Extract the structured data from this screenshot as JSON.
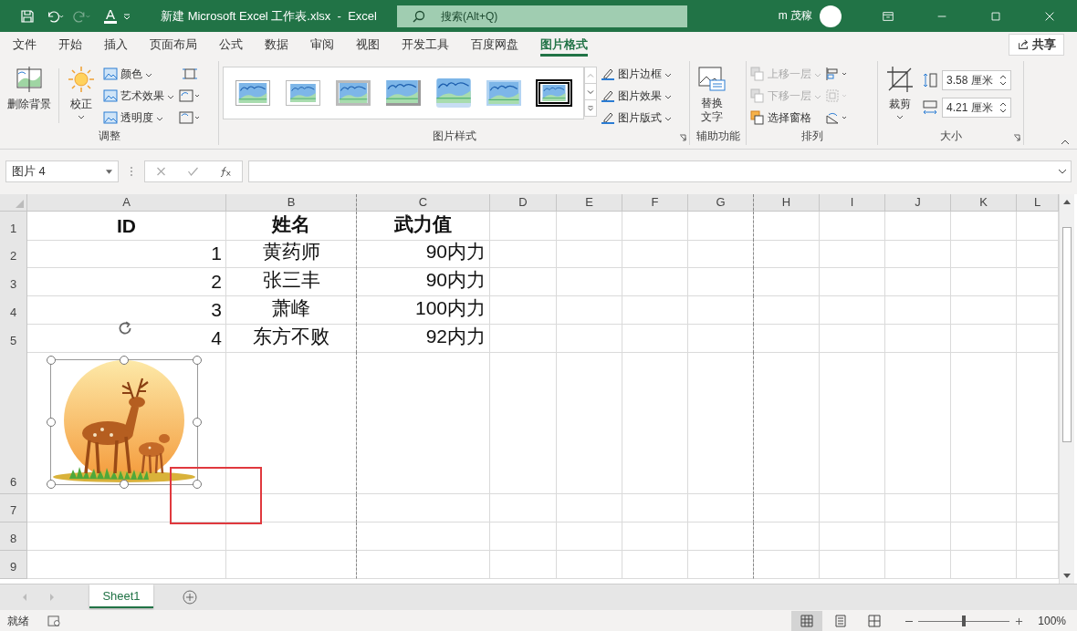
{
  "title_bar": {
    "title": "新建 Microsoft Excel 工作表.xlsx  -  Excel",
    "font_color_glyph": "A",
    "redo_disabled": true,
    "search": {
      "placeholder": "搜索(Alt+Q)"
    },
    "user": "m 茂稼"
  },
  "ribbon_tabs": [
    {
      "label": "文件",
      "selected": false
    },
    {
      "label": "开始",
      "selected": false
    },
    {
      "label": "插入",
      "selected": false
    },
    {
      "label": "页面布局",
      "selected": false
    },
    {
      "label": "公式",
      "selected": false
    },
    {
      "label": "数据",
      "selected": false
    },
    {
      "label": "审阅",
      "selected": false
    },
    {
      "label": "视图",
      "selected": false
    },
    {
      "label": "开发工具",
      "selected": false
    },
    {
      "label": "百度网盘",
      "selected": false
    },
    {
      "label": "图片格式",
      "selected": true
    }
  ],
  "share": "共享",
  "ribbon": {
    "adjust": {
      "label": "调整",
      "remove_background": "删除背景",
      "corrections": "校正",
      "items": [
        {
          "label": "颜色"
        },
        {
          "label": "艺术效果"
        },
        {
          "label": "透明度"
        }
      ]
    },
    "styles": {
      "label": "图片样式",
      "gallery": [
        {
          "kind": "simple"
        },
        {
          "kind": "bevel"
        },
        {
          "kind": "thick"
        },
        {
          "kind": "shadow"
        },
        {
          "kind": "reflect"
        },
        {
          "kind": "soft"
        },
        {
          "kind": "double"
        }
      ],
      "items": [
        {
          "label": "图片边框"
        },
        {
          "label": "图片效果"
        },
        {
          "label": "图片版式"
        }
      ]
    },
    "accessibility": {
      "label": "辅助功能",
      "alt_text": "替换文字"
    },
    "arrange": {
      "label": "排列",
      "items": [
        {
          "label": "上移一层",
          "disabled": true
        },
        {
          "label": "下移一层",
          "disabled": true
        },
        {
          "label": "选择窗格",
          "disabled": false
        }
      ],
      "tools": [
        {
          "kind": "align",
          "disabled": false
        },
        {
          "kind": "group",
          "disabled": true
        },
        {
          "kind": "rotate",
          "disabled": false
        }
      ]
    },
    "size": {
      "label": "大小",
      "crop": "裁剪",
      "height": "3.58 厘米",
      "width": "4.21 厘米"
    }
  },
  "formula_bar": {
    "name_box": "图片 4"
  },
  "columns": [
    {
      "label": "A",
      "page_break_before": false
    },
    {
      "label": "B",
      "page_break_before": false
    },
    {
      "label": "C",
      "page_break_before": true
    },
    {
      "label": "D",
      "page_break_before": false
    },
    {
      "label": "E",
      "page_break_before": false
    },
    {
      "label": "F",
      "page_break_before": false
    },
    {
      "label": "G",
      "page_break_before": false
    },
    {
      "label": "H",
      "page_break_before": true
    },
    {
      "label": "I",
      "page_break_before": false
    },
    {
      "label": "J",
      "page_break_before": false
    },
    {
      "label": "K",
      "page_break_before": false
    },
    {
      "label": "L",
      "page_break_before": false
    }
  ],
  "rows": [
    {
      "number": "1",
      "kind": "header",
      "cells": [
        "ID",
        "姓名",
        "武力值"
      ]
    },
    {
      "number": "2",
      "kind": "data",
      "cells": [
        "1",
        "黄药师",
        "90内力"
      ]
    },
    {
      "number": "3",
      "kind": "data",
      "cells": [
        "2",
        "张三丰",
        "90内力"
      ]
    },
    {
      "number": "4",
      "kind": "data",
      "cells": [
        "3",
        "萧峰",
        "100内力"
      ]
    },
    {
      "number": "5",
      "kind": "data",
      "cells": [
        "4",
        "东方不败",
        "92内力"
      ]
    },
    {
      "number": "6",
      "kind": "picture",
      "cells": []
    },
    {
      "number": "7",
      "kind": "data",
      "cells": []
    },
    {
      "number": "8",
      "kind": "data",
      "cells": []
    },
    {
      "number": "9",
      "kind": "data",
      "cells": []
    }
  ],
  "picture": {
    "selected": true
  },
  "sheet_tabs": [
    {
      "label": "Sheet1",
      "selected": true
    }
  ],
  "status_bar": {
    "status": "就绪",
    "views": [
      {
        "kind": "normal",
        "selected": true
      },
      {
        "kind": "page_layout",
        "selected": false
      },
      {
        "kind": "page_break",
        "selected": false
      }
    ],
    "zoom_slider": {
      "level": 0.5
    },
    "zoom": "100%"
  }
}
